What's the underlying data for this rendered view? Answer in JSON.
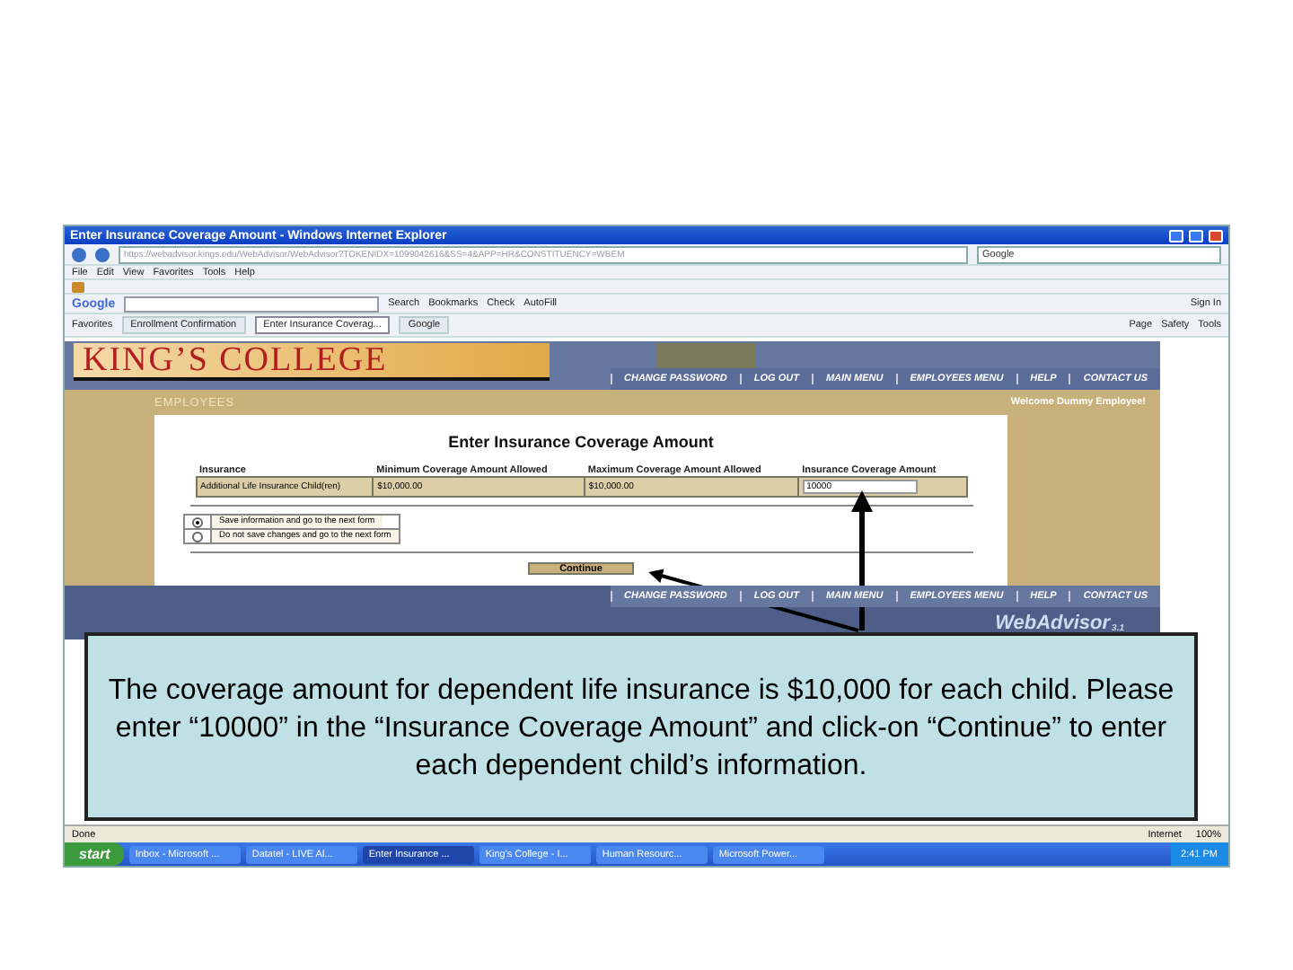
{
  "window": {
    "title": "Enter Insurance Coverage Amount - Windows Internet Explorer"
  },
  "address_bar": {
    "url": "https://webadvisor.kings.edu/WebAdvisor/WebAdvisor?TOKENIDX=1099042616&SS=4&APP=HR&CONSTITUENCY=WBEM",
    "search_placeholder": "Google"
  },
  "menu": [
    "File",
    "Edit",
    "View",
    "Favorites",
    "Tools",
    "Help"
  ],
  "google_bar": {
    "logo": "Google",
    "items": [
      "Search",
      "Bookmarks",
      "Check",
      "AutoFill"
    ],
    "sign_in": "Sign In"
  },
  "favorites_bar": {
    "label": "Favorites",
    "tabs": [
      {
        "label": "Enrollment Confirmation",
        "selected": false
      },
      {
        "label": "Enter Insurance Coverag...",
        "selected": true
      },
      {
        "label": "Google",
        "selected": false
      }
    ],
    "commands": [
      "Page",
      "Safety",
      "Tools"
    ]
  },
  "site": {
    "logo": "KING’S COLLEGE",
    "nav": [
      "CHANGE PASSWORD",
      "LOG OUT",
      "MAIN MENU",
      "EMPLOYEES MENU",
      "HELP",
      "CONTACT US"
    ],
    "section": "EMPLOYEES",
    "welcome": "Welcome Dummy Employee!",
    "heading": "Enter Insurance Coverage Amount",
    "table": {
      "columns": [
        "Insurance",
        "Minimum Coverage Amount Allowed",
        "Maximum Coverage Amount Allowed",
        "Insurance Coverage Amount"
      ],
      "row": {
        "insurance": "Additional Life Insurance Child(ren)",
        "minimum": "$10,000.00",
        "maximum": "$10,000.00",
        "amount": "10000"
      }
    },
    "options": [
      {
        "label": "Save information and go to the next form",
        "selected": true
      },
      {
        "label": "Do not save changes and go to the next form",
        "selected": false
      }
    ],
    "continue_button": "Continue",
    "footer_nav": [
      "CHANGE PASSWORD",
      "LOG OUT",
      "MAIN MENU",
      "EMPLOYEES MENU",
      "HELP",
      "CONTACT US"
    ],
    "footer_logo": "WebAdvisor",
    "footer_version": "3.1"
  },
  "status_bar": {
    "text": "Done",
    "zone": "Internet",
    "zoom": "100%"
  },
  "taskbar": {
    "start": "start",
    "items": [
      {
        "label": "Inbox - Microsoft ...",
        "selected": false
      },
      {
        "label": "Datatel - LIVE Al...",
        "selected": false
      },
      {
        "label": "Enter Insurance ...",
        "selected": true
      },
      {
        "label": "King's College - I...",
        "selected": false
      },
      {
        "label": "Human Resourc...",
        "selected": false
      },
      {
        "label": "Microsoft Power...",
        "selected": false
      }
    ],
    "clock": "2:41 PM"
  },
  "callout": {
    "text": "The coverage amount for dependent life insurance is $10,000 for each child. Please enter “10000” in the “Insurance Coverage Amount” and click-on “Continue” to enter each dependent child’s information."
  }
}
